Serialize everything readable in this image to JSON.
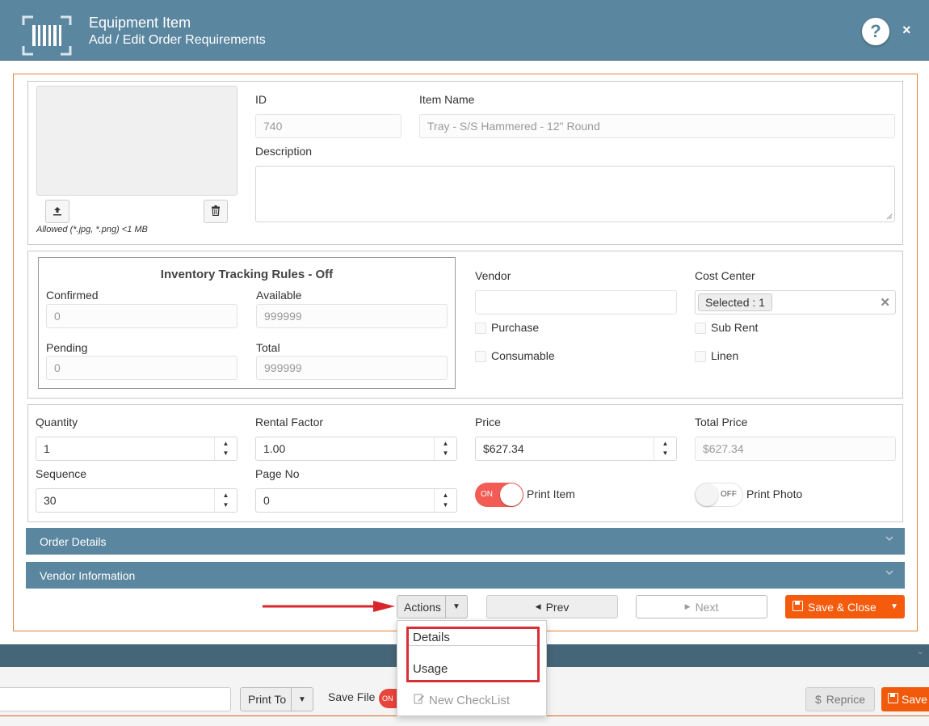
{
  "modal": {
    "title": "Equipment Item",
    "subtitle": "Add / Edit Order Requirements",
    "help_label": "?",
    "close_label": "×"
  },
  "photo": {
    "allowed_text": "Allowed (*.jpg, *.png) <1 MB"
  },
  "item": {
    "id_label": "ID",
    "id_value": "740",
    "name_label": "Item Name",
    "name_value": "Tray - S/S Hammered - 12\" Round",
    "description_label": "Description",
    "description_value": ""
  },
  "inventory": {
    "title": "Inventory Tracking Rules - Off",
    "confirmed_label": "Confirmed",
    "confirmed_value": "0",
    "available_label": "Available",
    "available_value": "999999",
    "pending_label": "Pending",
    "pending_value": "0",
    "total_label": "Total",
    "total_value": "999999"
  },
  "vendor": {
    "vendor_label": "Vendor",
    "vendor_value": "",
    "cost_center_label": "Cost Center",
    "cost_center_tag": "Selected : 1",
    "purchase_label": "Purchase",
    "purchase_checked": false,
    "sub_rent_label": "Sub Rent",
    "sub_rent_checked": false,
    "consumable_label": "Consumable",
    "consumable_checked": false,
    "linen_label": "Linen",
    "linen_checked": false
  },
  "pricing": {
    "quantity_label": "Quantity",
    "quantity_value": "1",
    "rental_factor_label": "Rental Factor",
    "rental_factor_value": "1.00",
    "price_label": "Price",
    "price_value": "$627.34",
    "total_price_label": "Total Price",
    "total_price_value": "$627.34",
    "sequence_label": "Sequence",
    "sequence_value": "30",
    "page_no_label": "Page No",
    "page_no_value": "0",
    "print_item_label": "Print Item",
    "print_item_state": "ON",
    "print_photo_label": "Print Photo",
    "print_photo_state": "OFF"
  },
  "sections": {
    "order_details": "Order Details",
    "vendor_information": "Vendor Information"
  },
  "footer": {
    "actions_label": "Actions",
    "prev_label": "Prev",
    "next_label": "Next",
    "save_close_label": "Save & Close"
  },
  "actions_menu": {
    "items": [
      "Details",
      "Usage"
    ],
    "new_checklist": "New CheckList"
  },
  "background": {
    "print_to_label": "Print To",
    "save_file_label": "Save File",
    "save_file_toggle": "ON",
    "reprice_label": "Reprice",
    "save_label": "Save"
  },
  "colors": {
    "header": "#5b869f",
    "accent_orange": "#f45b0c",
    "toggle_on": "#f25c54",
    "highlight_red": "#d82f36"
  }
}
